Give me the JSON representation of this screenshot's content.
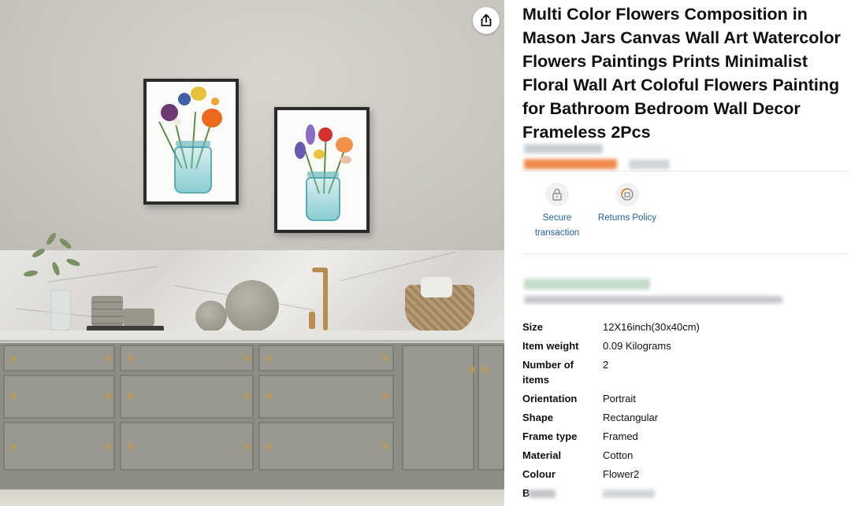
{
  "product": {
    "title": "Multi Color Flowers Composition in Mason Jars Canvas Wall Art Watercolor Flowers Paintings Prints Minimalist Floral Wall Art Coloful Flowers Painting for Bathroom Bedroom Wall Decor Frameless 2Pcs",
    "share_icon": "share-icon"
  },
  "features": [
    {
      "icon": "lock-icon",
      "label": "Secure transaction"
    },
    {
      "icon": "returns-icon",
      "label": "Returns Policy"
    }
  ],
  "specs": [
    {
      "key": "Size",
      "value": "12X16inch(30x40cm)"
    },
    {
      "key": "Item weight",
      "value": "0.09 Kilograms"
    },
    {
      "key": "Number of items",
      "value": "2"
    },
    {
      "key": "Orientation",
      "value": "Portrait"
    },
    {
      "key": "Shape",
      "value": "Rectangular"
    },
    {
      "key": "Frame type",
      "value": "Framed"
    },
    {
      "key": "Material",
      "value": "Cotton"
    },
    {
      "key": "Colour",
      "value": "Flower2"
    },
    {
      "key": "B",
      "value": ""
    }
  ],
  "colors": {
    "link": "#2162a1",
    "price_blur": "#f08a4b",
    "divider": "#e3e6e6"
  }
}
